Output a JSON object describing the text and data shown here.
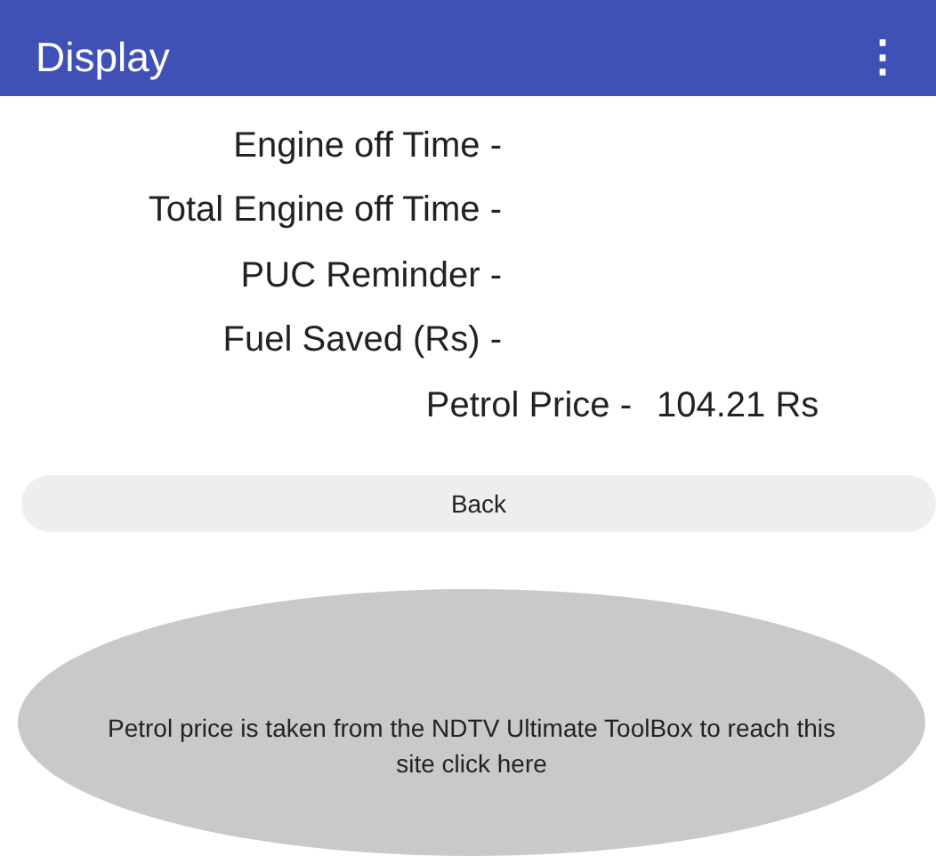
{
  "app_bar": {
    "title": "Display",
    "menu_icon": "⋮"
  },
  "rows": [
    {
      "label": "Engine off Time -"
    },
    {
      "label": "Total Engine off Time -"
    },
    {
      "label": "PUC Reminder -"
    },
    {
      "label": "Fuel Saved (Rs) -"
    },
    {
      "label": "Petrol Price -",
      "value": "104.21 Rs"
    }
  ],
  "back_button": "Back",
  "info_button": "Petrol price is taken from the NDTV Ultimate ToolBox to reach this site click here"
}
